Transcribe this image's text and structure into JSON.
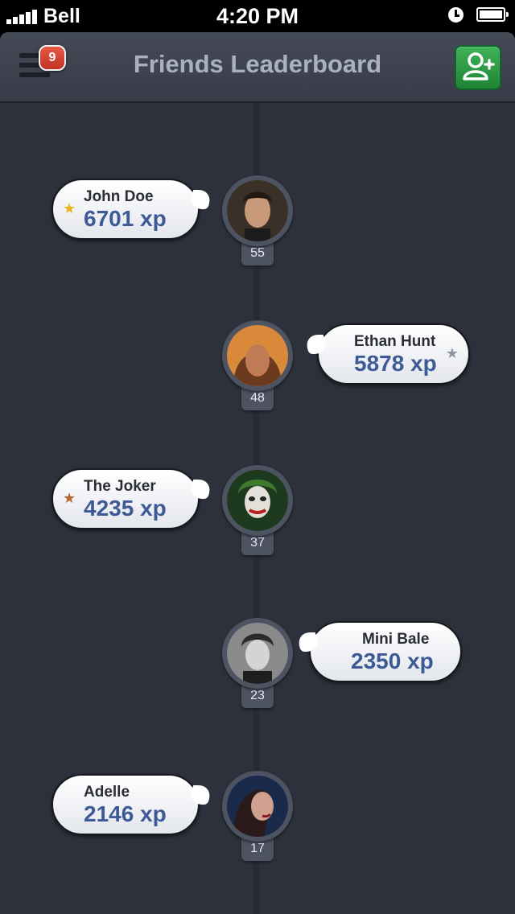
{
  "status_bar": {
    "carrier": "Bell",
    "time": "4:20 PM"
  },
  "header": {
    "title": "Friends Leaderboard",
    "notification_count": "9"
  },
  "colors": {
    "gold_star": "#e6b31e",
    "silver_star": "#8c95a6",
    "bronze_star": "#b8652a",
    "xp_text": "#3e5a96",
    "add_button": "#2a9a45",
    "badge": "#d34331"
  },
  "friends": [
    {
      "name": "John Doe",
      "xp": "6701 xp",
      "level": "55",
      "star": "gold_star"
    },
    {
      "name": "Ethan Hunt",
      "xp": "5878 xp",
      "level": "48",
      "star": "silver_star"
    },
    {
      "name": "The Joker",
      "xp": "4235 xp",
      "level": "37",
      "star": "bronze_star"
    },
    {
      "name": "Mini Bale",
      "xp": "2350 xp",
      "level": "23",
      "star": ""
    },
    {
      "name": "Adelle",
      "xp": "2146 xp",
      "level": "17",
      "star": ""
    }
  ]
}
